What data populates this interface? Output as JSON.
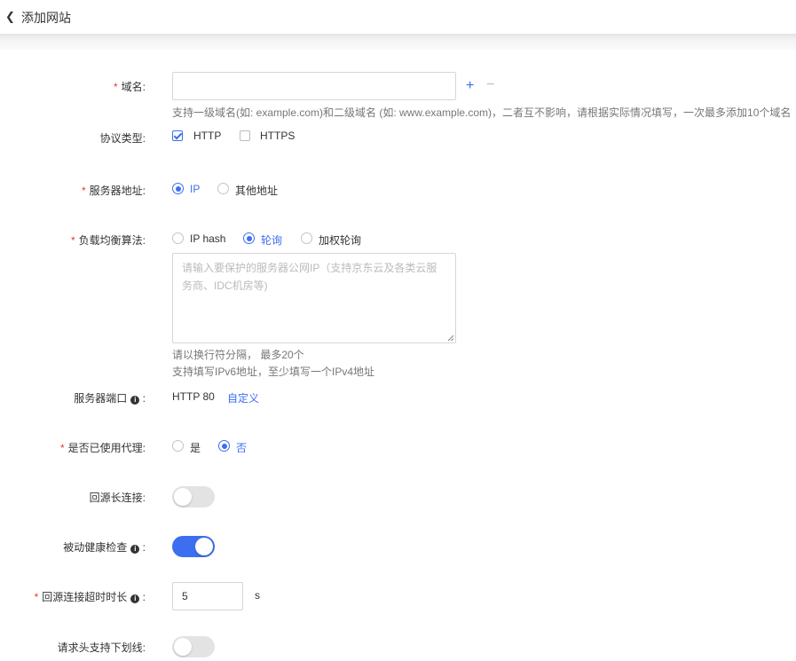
{
  "header": {
    "back_icon": "chevron-left-icon",
    "title": "添加网站"
  },
  "form": {
    "domain": {
      "required_mark": "*",
      "label": "域名:",
      "value": "",
      "add_symbol": "+",
      "remove_symbol": "−",
      "hint": "支持一级域名(如: example.com)和二级域名 (如: www.example.com)，二者互不影响，请根据实际情况填写，一次最多添加10个域名"
    },
    "protocol": {
      "label": "协议类型:",
      "options": [
        {
          "label": "HTTP",
          "checked": true
        },
        {
          "label": "HTTPS",
          "checked": false
        }
      ]
    },
    "server_address": {
      "required_mark": "*",
      "label": "服务器地址:",
      "options": [
        {
          "label": "IP",
          "selected": true
        },
        {
          "label": "其他地址",
          "selected": false
        }
      ]
    },
    "load_balance": {
      "required_mark": "*",
      "label": "负载均衡算法:",
      "options": [
        {
          "label": "IP hash",
          "selected": false
        },
        {
          "label": "轮询",
          "selected": true
        },
        {
          "label": "加权轮询",
          "selected": false
        }
      ],
      "textarea_placeholder": "请输入要保护的服务器公网IP（支持京东云及各类云服务商、IDC机房等)",
      "hint_line1": "请以换行符分隔， 最多20个",
      "hint_line2": "支持填写IPv6地址，至少填写一个IPv4地址"
    },
    "server_port": {
      "label": "服务器端口",
      "colon": ":",
      "value": "HTTP 80",
      "custom_link": "自定义"
    },
    "proxy": {
      "required_mark": "*",
      "label": "是否已使用代理:",
      "options": [
        {
          "label": "是",
          "selected": false
        },
        {
          "label": "否",
          "selected": true
        }
      ]
    },
    "keepalive": {
      "label": "回源长连接:",
      "on": false
    },
    "health_check": {
      "label": "被动健康检查",
      "colon": ":",
      "on": true
    },
    "timeout": {
      "required_mark": "*",
      "label": "回源连接超时时长",
      "colon": ":",
      "value": "5",
      "unit": "s"
    },
    "underscore_header": {
      "label": "请求头支持下划线:",
      "on": false
    }
  },
  "colors": {
    "accent": "#3c6ef0",
    "required": "#e4393c"
  }
}
